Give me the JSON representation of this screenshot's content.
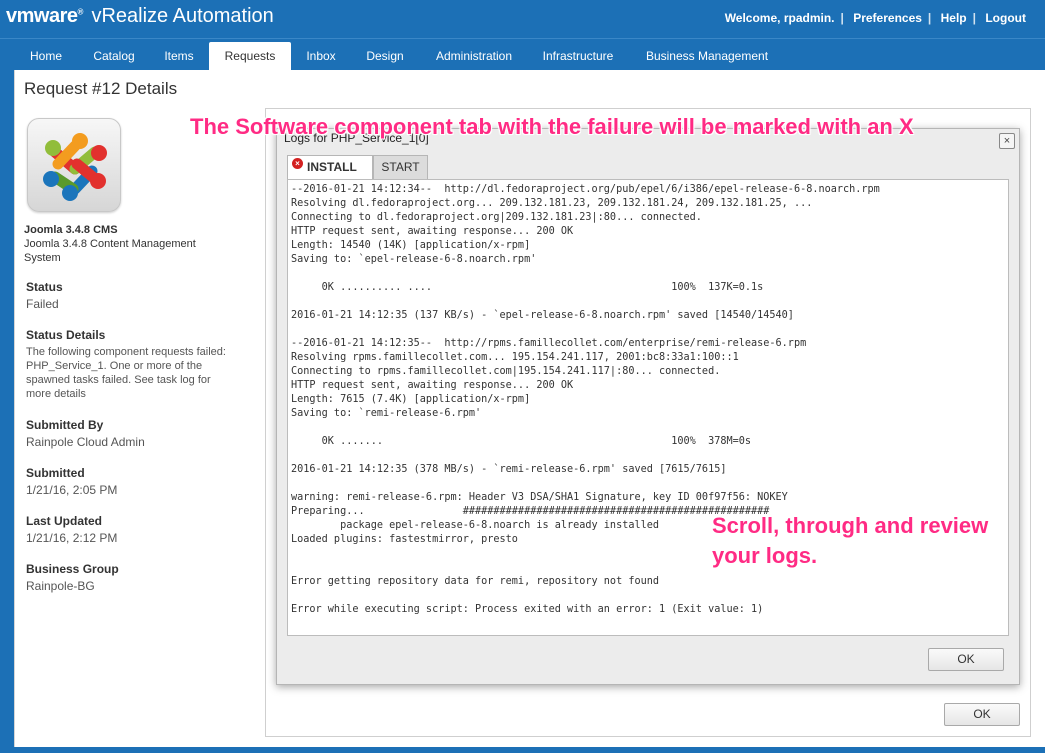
{
  "header": {
    "brand_vm": "vm",
    "brand_ware": "ware",
    "brand_product": "vRealize Automation",
    "welcome": "Welcome, rpadmin.",
    "preferences": "Preferences",
    "help": "Help",
    "logout": "Logout"
  },
  "nav": {
    "tabs": [
      {
        "label": "Home"
      },
      {
        "label": "Catalog"
      },
      {
        "label": "Items"
      },
      {
        "label": "Requests"
      },
      {
        "label": "Inbox"
      },
      {
        "label": "Design"
      },
      {
        "label": "Administration"
      },
      {
        "label": "Infrastructure"
      },
      {
        "label": "Business Management"
      }
    ],
    "active": "Requests"
  },
  "page": {
    "title": "Request #12 Details"
  },
  "item": {
    "name": "Joomla 3.4.8 CMS",
    "description": "Joomla 3.4.8 Content Management System",
    "logo_icon": "joomla-logo-icon"
  },
  "details": {
    "status_label": "Status",
    "status_value": "Failed",
    "status_details_label": "Status Details",
    "status_details_value": "The following component requests failed: PHP_Service_1. One or more of the spawned tasks failed. See task log for more details",
    "submitted_by_label": "Submitted By",
    "submitted_by_value": "Rainpole Cloud Admin",
    "submitted_label": "Submitted",
    "submitted_value": "1/21/16, 2:05 PM",
    "last_updated_label": "Last Updated",
    "last_updated_value": "1/21/16, 2:12 PM",
    "business_group_label": "Business Group",
    "business_group_value": "Rainpole-BG"
  },
  "dialog": {
    "title": "Logs for PHP_Service_1[0]",
    "close_glyph": "×",
    "tabs": {
      "install": "INSTALL",
      "start": "START"
    },
    "error_glyph": "×",
    "log_text": "--2016-01-21 14:12:34--  http://dl.fedoraproject.org/pub/epel/6/i386/epel-release-6-8.noarch.rpm\nResolving dl.fedoraproject.org... 209.132.181.23, 209.132.181.24, 209.132.181.25, ...\nConnecting to dl.fedoraproject.org|209.132.181.23|:80... connected.\nHTTP request sent, awaiting response... 200 OK\nLength: 14540 (14K) [application/x-rpm]\nSaving to: `epel-release-6-8.noarch.rpm'\n\n     0K .......... ....                                       100%  137K=0.1s\n\n2016-01-21 14:12:35 (137 KB/s) - `epel-release-6-8.noarch.rpm' saved [14540/14540]\n\n--2016-01-21 14:12:35--  http://rpms.famillecollet.com/enterprise/remi-release-6.rpm\nResolving rpms.famillecollet.com... 195.154.241.117, 2001:bc8:33a1:100::1\nConnecting to rpms.famillecollet.com|195.154.241.117|:80... connected.\nHTTP request sent, awaiting response... 200 OK\nLength: 7615 (7.4K) [application/x-rpm]\nSaving to: `remi-release-6.rpm'\n\n     0K .......                                               100%  378M=0s\n\n2016-01-21 14:12:35 (378 MB/s) - `remi-release-6.rpm' saved [7615/7615]\n\nwarning: remi-release-6.rpm: Header V3 DSA/SHA1 Signature, key ID 00f97f56: NOKEY\nPreparing...                ##################################################\n        package epel-release-6-8.noarch is already installed\nLoaded plugins: fastestmirror, presto\n\n\nError getting repository data for remi, repository not found\n\nError while executing script: Process exited with an error: 1 (Exit value: 1)",
    "ok_label": "OK"
  },
  "main_ok_label": "OK",
  "annotations": {
    "tab_note": "The Software component tab with the failure will be marked with an X",
    "scroll_note_line1": "Scroll, through and review",
    "scroll_note_line2": "your logs."
  },
  "colors": {
    "header_blue": "#1c70b6",
    "annotation_pink": "#ff2b84",
    "error_red": "#d32020"
  }
}
